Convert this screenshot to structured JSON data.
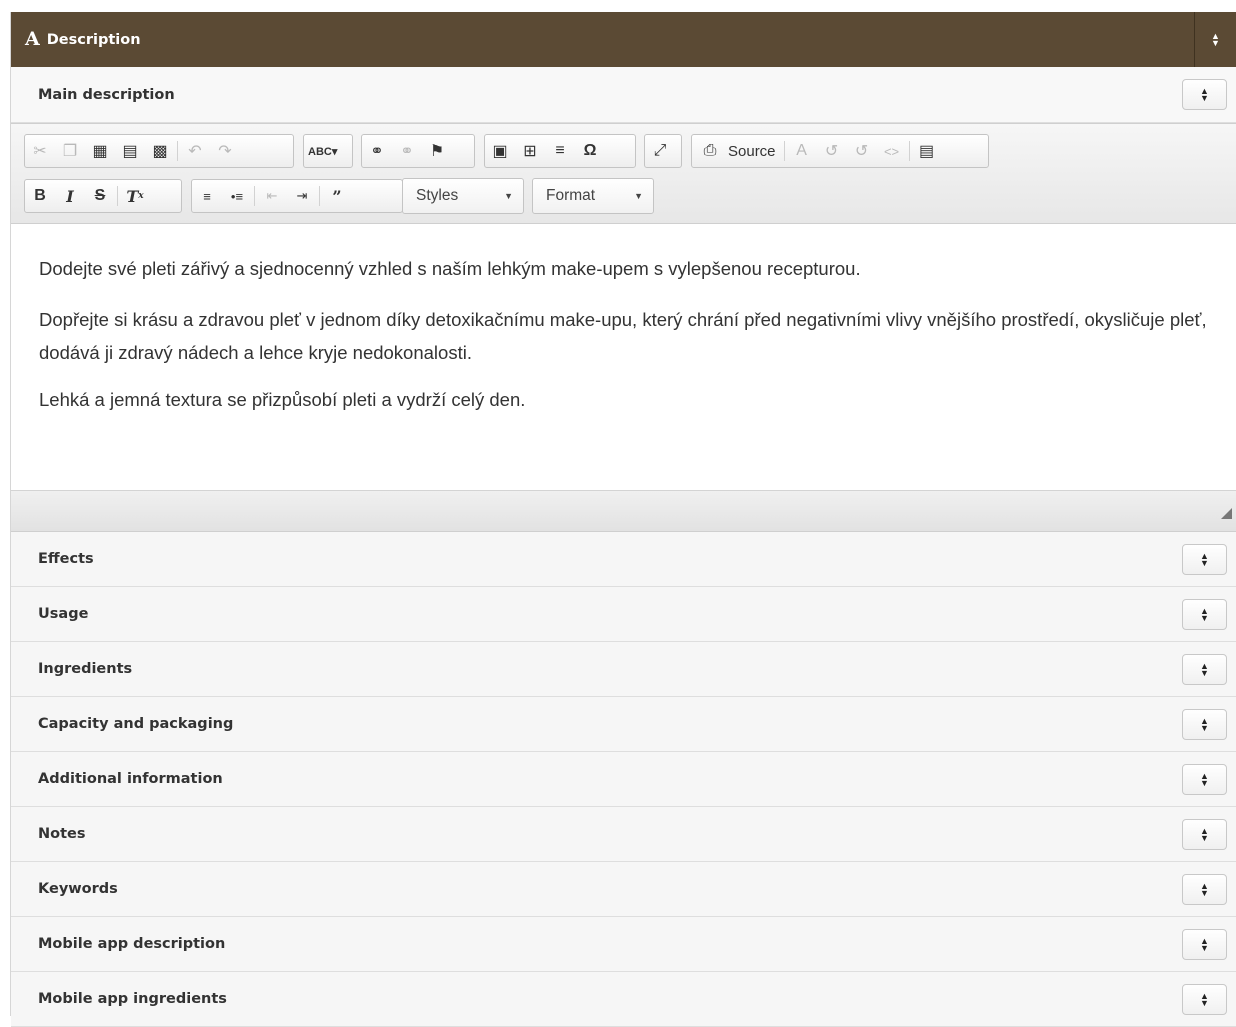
{
  "header": {
    "icon": "A",
    "title": "Description",
    "toggle_icon": "sort-icon"
  },
  "main_section": {
    "label": "Main description",
    "toggle_icon": "sort-icon"
  },
  "toolbar": {
    "source_label": "Source",
    "styles_label": "Styles",
    "format_label": "Format",
    "icons": {
      "cut": "✂",
      "copy": "⎘",
      "paste": "📋",
      "undo": "↶",
      "redo": "↷",
      "spell": "ABC",
      "link": "∞",
      "unlink": "⊘",
      "anchor": "⚑",
      "image": "▣",
      "table": "⊞",
      "hr": "≡",
      "special": "Ω",
      "maximize": "⤢",
      "source": "⎙",
      "find": "A",
      "templates": "◫",
      "bold": "B",
      "italic": "I",
      "strike": "S",
      "removeformat": "Tx",
      "numbered": "⒈≡",
      "bulleted": "•≡",
      "outdent": "⇤",
      "indent": "⇥",
      "quote": "99"
    }
  },
  "content": {
    "paragraphs": [
      "Dodejte své pleti zářivý a sjednocenný vzhled s naším lehkým make-upem s vylepšenou recepturou.",
      "Dopřejte si krásu a zdravou pleť v jednom díky detoxikačnímu make-upu, který chrání před negativními vlivy vnějšího prostředí, okysličuje pleť, dodává ji zdravý nádech a lehce kryje nedokonalosti.",
      "Lehká a jemná textura se přizpůsobí pleti a vydrží celý den."
    ]
  },
  "sections": [
    "Effects",
    "Usage",
    "Ingredients",
    "Capacity and packaging",
    "Additional information",
    "Notes",
    "Keywords",
    "Mobile app description",
    "Mobile app ingredients"
  ],
  "colors": {
    "header_bg": "#5b4a34",
    "row_bg": "#f6f6f6",
    "text": "#333333"
  }
}
